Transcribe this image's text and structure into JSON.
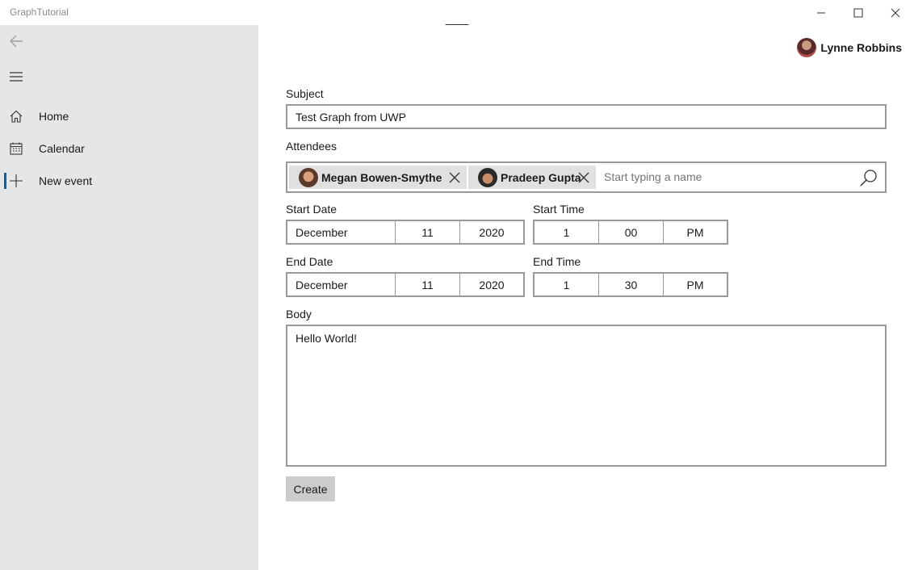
{
  "app": {
    "title": "GraphTutorial"
  },
  "window_controls": {
    "minimize_icon": "minimize-icon",
    "maximize_icon": "maximize-icon",
    "close_icon": "close-icon"
  },
  "sidebar": {
    "back_icon": "back-arrow-icon",
    "menu_icon": "hamburger-icon",
    "items": [
      {
        "label": "Home",
        "icon": "home-icon",
        "selected": false
      },
      {
        "label": "Calendar",
        "icon": "calendar-icon",
        "selected": false
      },
      {
        "label": "New event",
        "icon": "plus-icon",
        "selected": true
      }
    ],
    "accent_color": "#0063b1",
    "background_color": "#e6e6e6"
  },
  "user": {
    "name": "Lynne Robbins"
  },
  "form": {
    "subject": {
      "label": "Subject",
      "value": "Test Graph from UWP"
    },
    "attendees": {
      "label": "Attendees",
      "tokens": [
        {
          "name": "Megan Bowen-Smythe"
        },
        {
          "name": "Pradeep Gupta"
        }
      ],
      "placeholder": "Start typing a name"
    },
    "start_date": {
      "label": "Start Date",
      "month": "December",
      "day": "11",
      "year": "2020"
    },
    "start_time": {
      "label": "Start Time",
      "hour": "1",
      "minute": "00",
      "period": "PM"
    },
    "end_date": {
      "label": "End Date",
      "month": "December",
      "day": "11",
      "year": "2020"
    },
    "end_time": {
      "label": "End Time",
      "hour": "1",
      "minute": "30",
      "period": "PM"
    },
    "body": {
      "label": "Body",
      "value": "Hello World!"
    },
    "create_label": "Create"
  }
}
